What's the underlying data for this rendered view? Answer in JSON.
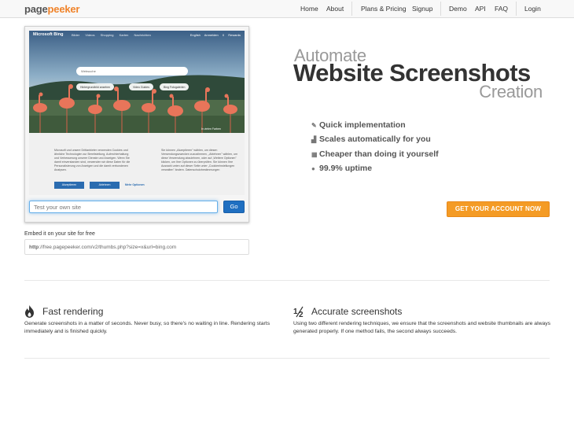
{
  "nav": {
    "logo_a": "page",
    "logo_b": "peeker",
    "items": [
      "Home",
      "About",
      "Plans & Pricing",
      "Signup",
      "Demo",
      "API",
      "FAQ",
      "Login"
    ]
  },
  "preview": {
    "bing_logo": "Microsoft Bing",
    "bing_links": "Bilder Videos Shopping Karten Nachrichten",
    "bing_right": "English Anmelden 0 Rewards",
    "search_text": "Websuche",
    "pills": [
      "Hintergrundbild ansehen",
      "Video Guides",
      "Bing Fotogalerien"
    ],
    "caption_tag": "In vielen Farben",
    "consent_left": "Microsoft und unsere Drittanbieter verwenden Cookies und ähnliche Technologien zur Bereitstellung, Aufrechterhaltung und Verbesserung unserer Dienste und Anzeigen. Wenn Sie damit einverstanden sind, verwenden wir diese Daten für die Personalisierung von Anzeigen und die damit verbundenen Analysen.",
    "consent_right": "Sie können „Akzeptieren\" wählen, um diesen Verwendungszwecken zuzustimmen, „Ablehnen\" wählen, um diese Verwendung abzulehnen, oder auf „Weitere Optionen\" klicken, um Ihre Optionen zu überprüfen. Sie können Ihre Auswahl unten auf dieser Seite unter „Cookieeinstellungen verwalten\" ändern. Datenschutzbestimmungen",
    "btn_accept": "Akzeptieren",
    "btn_reject": "Ablehnen",
    "btn_more": "Mehr Optionen",
    "input_placeholder": "Test your own site",
    "go_label": "Go"
  },
  "embed": {
    "label": "Embed it on your site for free",
    "code_bold": "http",
    "code_rest": "://free.pagepeeker.com/v2/thumbs.php?size=x&url=bing.com"
  },
  "headline": {
    "automate": "Automate",
    "main": "Website Screenshots",
    "creation": "Creation"
  },
  "features": [
    {
      "icon": "pencil-icon",
      "glyph": "✎",
      "label": "Quick implementation"
    },
    {
      "icon": "signal-icon",
      "glyph": "▟",
      "label": "Scales automatically for you"
    },
    {
      "icon": "grid-icon",
      "glyph": "▦",
      "label": "Cheaper than doing it yourself"
    },
    {
      "icon": "check-circle-icon",
      "glyph": "●",
      "label": "99.9% uptime"
    }
  ],
  "cta": {
    "label": "GET YOUR ACCOUNT NOW"
  },
  "bottom": {
    "fast_title": "Fast rendering",
    "fast_text": "Generate screenshots in a matter of seconds. Never busy, so there's no waiting in line. Rendering starts immediately and is finished quickly.",
    "accurate_title": "Accurate screenshots",
    "accurate_text": "Using two different rendering techniques, we ensure that the screenshots and website thumbnails are always generated properly. If one method fails, the second always succeeds."
  },
  "colors": {
    "accent_orange": "#f49b25",
    "go_blue": "#1f6fc1",
    "logo_orange": "#f0832a"
  }
}
